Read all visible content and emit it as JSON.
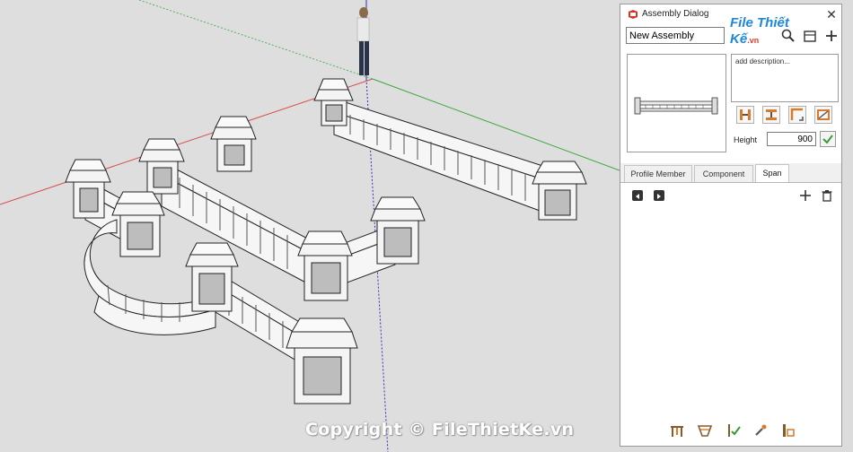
{
  "viewport": {
    "watermark": "Copyright © FileThietKe.vn"
  },
  "panel": {
    "title": "Assembly Dialog",
    "close_glyph": "✕",
    "logo_main": "File Thiết Kế",
    "logo_suffix": ".vn",
    "assembly_name": "New Assembly",
    "description_placeholder": "add description...",
    "height_label": "Height",
    "height_value": "900",
    "tabs": [
      {
        "label": "Profile Member",
        "active": false
      },
      {
        "label": "Component",
        "active": false
      },
      {
        "label": "Span",
        "active": true
      }
    ],
    "icons": {
      "search": "search-icon",
      "library": "library-icon",
      "add": "plus-icon",
      "span_prev": "prev-icon",
      "span_next": "next-icon",
      "span_add": "plus-icon",
      "span_delete": "trash-icon"
    },
    "colors": {
      "accent_green": "#3a9a3a",
      "logo_blue": "#1e88d8",
      "logo_red": "#e03c2c"
    }
  }
}
